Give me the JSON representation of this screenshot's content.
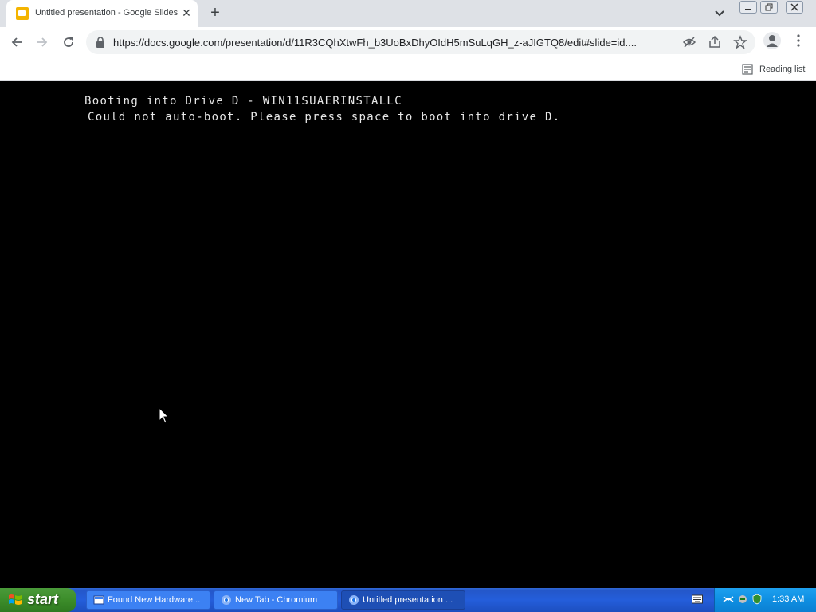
{
  "browser": {
    "tab": {
      "title": "Untitled presentation - Google Slides",
      "close": "✕"
    },
    "new_tab": "+",
    "url": "https://docs.google.com/presentation/d/11R3CQhXtwFh_b3UoBxDhyOIdH5mSuLqGH_z-aJIGTQ8/edit#slide=id....",
    "bookmarks": {
      "reading_list": "Reading list"
    }
  },
  "content": {
    "lines": [
      "Booting into Drive D - WIN11SUAERINSTALLC",
      "Could not auto-boot. Please press space to boot into drive D."
    ]
  },
  "taskbar": {
    "start": "start",
    "tasks": [
      {
        "label": "Found New Hardware...",
        "icon": "hardware-icon"
      },
      {
        "label": "New Tab - Chromium",
        "icon": "chromium-icon"
      },
      {
        "label": "Untitled presentation ...",
        "icon": "chromium-icon"
      }
    ],
    "clock": "1:33 AM"
  },
  "colors": {
    "taskbar": "#245edb",
    "start": "#3c8d2a",
    "tray": "#0f8fe2",
    "slides": "#f4b400"
  }
}
